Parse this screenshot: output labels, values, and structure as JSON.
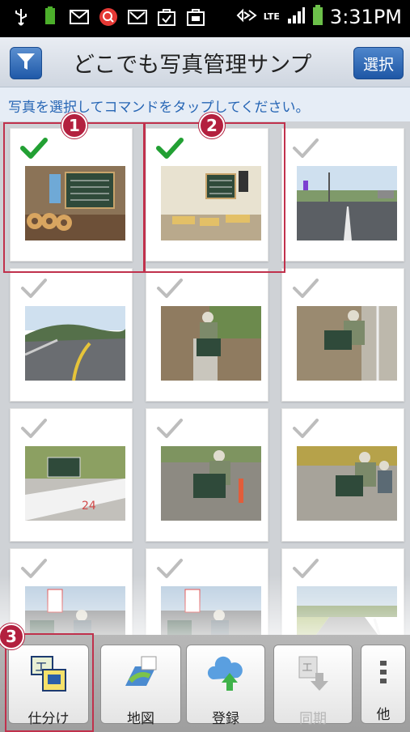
{
  "status_bar": {
    "time": "3:31PM",
    "network": "LTE",
    "icons": [
      "usb-icon",
      "battery-100-icon",
      "mail-icon",
      "search-app-icon",
      "gmail-icon",
      "bag-check-icon",
      "bag-icon",
      "nfc-icon",
      "signal-icon",
      "battery-icon"
    ]
  },
  "header": {
    "title": "どこでも写真管理サンプ",
    "filter_icon": "filter-icon",
    "select_label": "選択"
  },
  "instruction": "写真を選択してコマンドをタップしてください。",
  "callouts": [
    "1",
    "2",
    "3"
  ],
  "photos": [
    {
      "selected": true,
      "subject": "board-with-pipes"
    },
    {
      "selected": true,
      "subject": "board-with-lumber"
    },
    {
      "selected": false,
      "subject": "road"
    },
    {
      "selected": false,
      "subject": "curved-road"
    },
    {
      "selected": false,
      "subject": "worker-trench"
    },
    {
      "selected": false,
      "subject": "worker-guardrail"
    },
    {
      "selected": false,
      "subject": "board-roadside"
    },
    {
      "selected": false,
      "subject": "worker-board"
    },
    {
      "selected": false,
      "subject": "worker-kneeling"
    },
    {
      "selected": false,
      "subject": "workers-crosswalk"
    },
    {
      "selected": false,
      "subject": "workers-crosswalk-2"
    },
    {
      "selected": false,
      "subject": "road-rice-field"
    }
  ],
  "toolbar": {
    "items": [
      {
        "label": "仕分け",
        "icon": "sort-icon",
        "enabled": true
      },
      {
        "label": "地図",
        "icon": "map-icon",
        "enabled": true
      },
      {
        "label": "登録",
        "icon": "cloud-upload-icon",
        "enabled": true
      },
      {
        "label": "同期",
        "icon": "sync-icon",
        "enabled": false
      },
      {
        "label": "他",
        "icon": "more-icon",
        "enabled": true
      }
    ]
  },
  "colors": {
    "accent": "#1f59a8",
    "instruction_text": "#2766b5",
    "callout": "#b3203f",
    "check_green": "#22a033",
    "check_gray": "#bdbdbd"
  }
}
